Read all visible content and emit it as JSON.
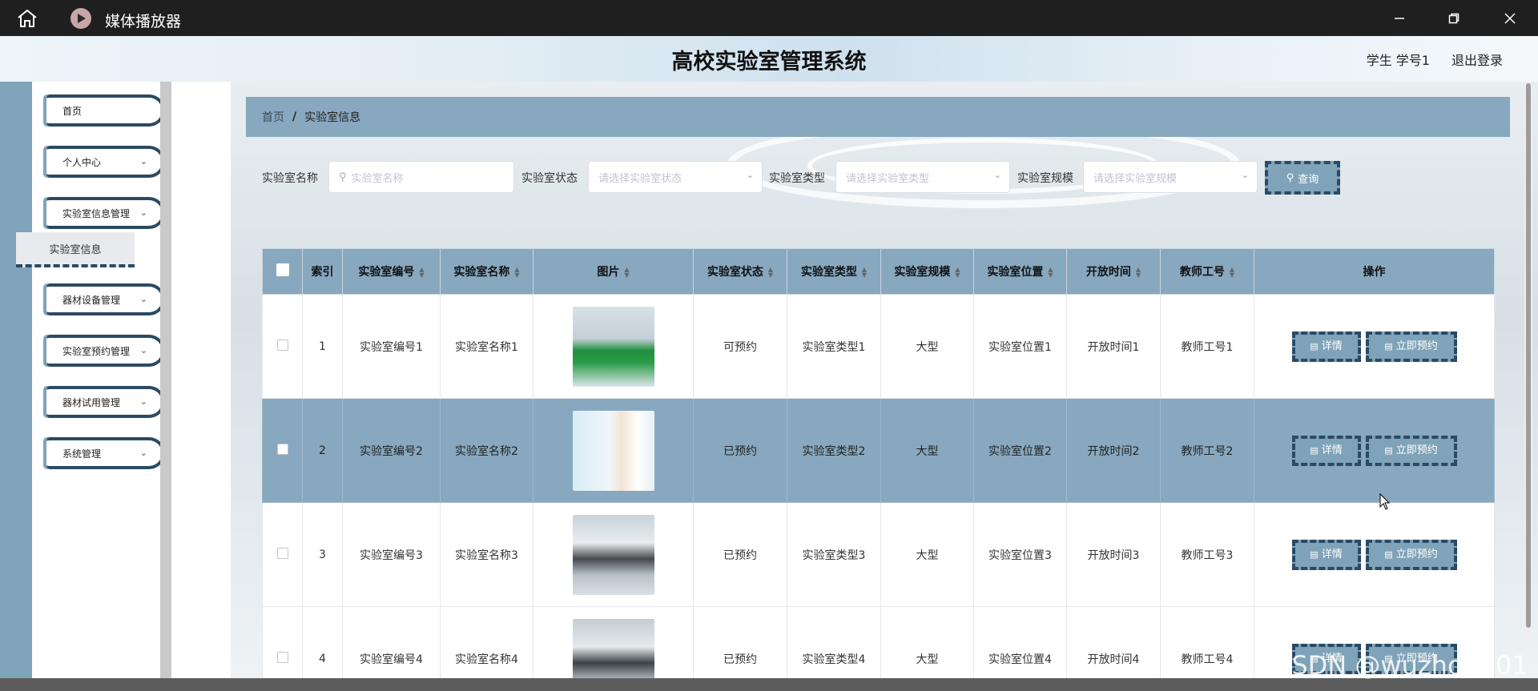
{
  "window": {
    "title": "媒体播放器"
  },
  "header": {
    "title": "高校实验室管理系统",
    "user": "学生 学号1",
    "logout": "退出登录"
  },
  "sidebar": {
    "items": [
      {
        "label": "首页"
      },
      {
        "label": "个人中心"
      },
      {
        "label": "实验室信息管理",
        "children": [
          {
            "label": "实验室信息",
            "active": true
          }
        ]
      },
      {
        "label": "器材设备管理"
      },
      {
        "label": "实验室预约管理"
      },
      {
        "label": "器材试用管理"
      },
      {
        "label": "系统管理"
      }
    ]
  },
  "breadcrumb": {
    "home": "首页",
    "separator": "/",
    "current": "实验室信息"
  },
  "search": {
    "name_label": "实验室名称",
    "name_placeholder": "实验室名称",
    "status_label": "实验室状态",
    "status_placeholder": "请选择实验室状态",
    "type_label": "实验室类型",
    "type_placeholder": "请选择实验室类型",
    "scale_label": "实验室规模",
    "scale_placeholder": "请选择实验室规模",
    "query_button": "查询"
  },
  "table": {
    "columns": [
      "索引",
      "实验室编号",
      "实验室名称",
      "图片",
      "实验室状态",
      "实验室类型",
      "实验室规模",
      "实验室位置",
      "开放时间",
      "教师工号",
      "操作"
    ],
    "rows": [
      {
        "index": "1",
        "code": "实验室编号1",
        "name": "实验室名称1",
        "status": "可预约",
        "type": "实验室类型1",
        "scale": "大型",
        "location": "实验室位置1",
        "open_time": "开放时间1",
        "teacher": "教师工号1"
      },
      {
        "index": "2",
        "code": "实验室编号2",
        "name": "实验室名称2",
        "status": "已预约",
        "type": "实验室类型2",
        "scale": "大型",
        "location": "实验室位置2",
        "open_time": "开放时间2",
        "teacher": "教师工号2"
      },
      {
        "index": "3",
        "code": "实验室编号3",
        "name": "实验室名称3",
        "status": "已预约",
        "type": "实验室类型3",
        "scale": "大型",
        "location": "实验室位置3",
        "open_time": "开放时间3",
        "teacher": "教师工号3"
      },
      {
        "index": "4",
        "code": "实验室编号4",
        "name": "实验室名称4",
        "status": "已预约",
        "type": "实验室类型4",
        "scale": "大型",
        "location": "实验室位置4",
        "open_time": "开放时间4",
        "teacher": "教师工号4"
      }
    ],
    "actions": {
      "detail": "详情",
      "book": "立即预约"
    }
  },
  "watermark": "CSDN @wuzhou101",
  "colors": {
    "accent": "#87a8bf",
    "border_dark": "#2b4a63",
    "titlebar": "#1f1f1f"
  }
}
